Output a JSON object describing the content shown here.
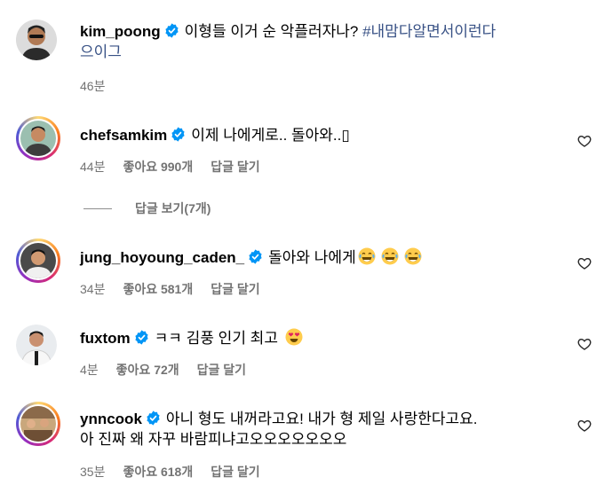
{
  "comments": [
    {
      "username": "kim_poong",
      "text_line1": "이형들 이거 순 악플러자나?",
      "hashtag": "#내맘다알면서이런다",
      "text_line2": "으이그",
      "time": "46분"
    },
    {
      "username": "chefsamkim",
      "text": "이제 나에게로.. 돌아와..▯",
      "time": "44분",
      "likes": "좋아요 990개",
      "reply": "답글 달기",
      "view_replies": "답글 보기(7개)"
    },
    {
      "username": "jung_hoyoung_caden_",
      "text": "돌아와 나에게",
      "emoji": "tears-of-joy-emoji",
      "time": "34분",
      "likes": "좋아요 581개",
      "reply": "답글 달기"
    },
    {
      "username": "fuxtom",
      "text": "ㅋㅋ 김풍 인기 최고",
      "emoji": "heart-eyes-emoji",
      "time": "4분",
      "likes": "좋아요 72개",
      "reply": "답글 달기"
    },
    {
      "username": "ynncook",
      "text_line1": "아니 형도 내꺼라고요! 내가 형 제일 사랑한다고요.",
      "text_line2": "아 진짜 왜 자꾸 바람피냐고오오오오오오오",
      "time": "35분",
      "likes": "좋아요 618개",
      "reply": "답글 달기"
    }
  ],
  "colors": {
    "verified": "#0095f6",
    "meta": "#737373",
    "hashtag": "#385185"
  },
  "icons": {
    "verified": "verified-badge-icon",
    "like": "heart-outline-icon"
  }
}
